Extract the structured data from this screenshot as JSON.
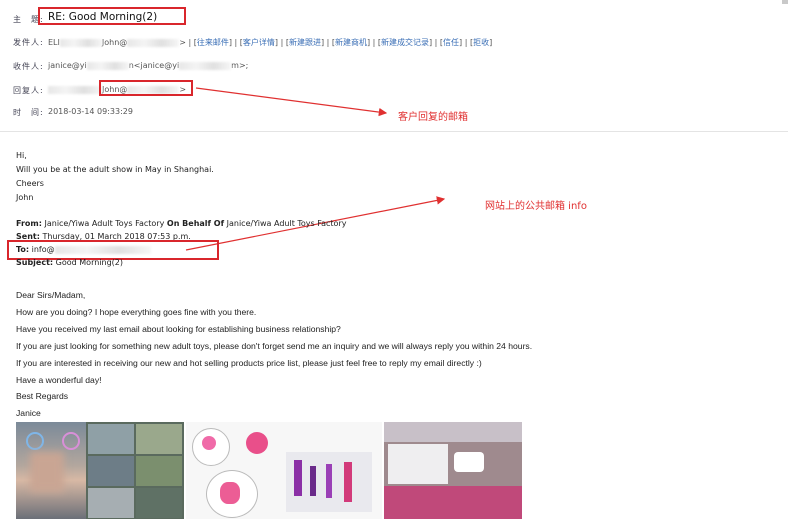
{
  "header": {
    "subject_label": "主　题:",
    "subject_value": "RE: Good Morning(2)",
    "from_label": "发件人:",
    "from_name_prefix": "ELI",
    "from_name_mid": "John@",
    "from_links": [
      "往来邮件",
      "客户详情",
      "新建跟进",
      "新建商机",
      "新建成交记录",
      "信任",
      "拒收"
    ],
    "to_label": "收件人:",
    "to_value_prefix": "janice@yi",
    "to_value_mid": "n<janice@yi",
    "to_value_suffix": "m>;",
    "reply_label": "回复人:",
    "reply_value_mid": "John@",
    "time_label": "时　间:",
    "time_value": "2018-03-14 09:33:29"
  },
  "annotations": {
    "reply_note": "客户回复的邮箱",
    "public_note": "网站上的公共邮箱 info"
  },
  "reply_body": {
    "line1": "Hi,",
    "line2": "Will you be at the adult show in May in Shanghai.",
    "line3": "Cheers",
    "line4": "John"
  },
  "quoted": {
    "from_label": "From:",
    "from_value_a": " Janice/Yiwa Adult Toys Factory ",
    "from_onbehalf": "On Behalf Of",
    "from_value_b": " Janice/Yiwa Adult Toys Factory",
    "sent_label": "Sent:",
    "sent_value": " Thursday, 01 March 2018 07:53 p.m.",
    "to_label": "To:",
    "to_value": " info@",
    "subject_label": "Subject:",
    "subject_value": " Good Morning(2)"
  },
  "message": {
    "greeting": "Dear Sirs/Madam,",
    "p1": "How are you doing? I hope everything goes fine with you there.",
    "p2": "Have you received my last email about looking for establishing business relationship?",
    "p3": "If you are just looking for something new adult toys, please don't forget send me an inquiry and we will always reply you within 24 hours.",
    "p4": "If you are interested in receiving our new and hot selling products price list, please just feel free to reply my email directly :)",
    "p5": "Have a wonderful day!",
    "closing": "Best Regards",
    "signature": "Janice"
  },
  "colors": {
    "accent_red": "#d9262c",
    "link_blue": "#3b6fb6",
    "annotation_red": "#e03030"
  },
  "icons": [
    "photo-strip-images"
  ]
}
